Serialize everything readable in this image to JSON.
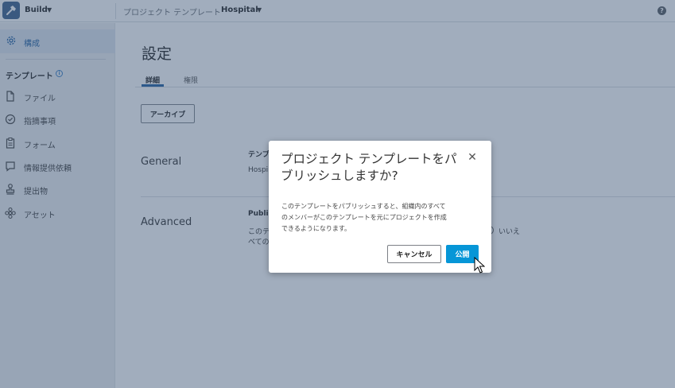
{
  "topbar": {
    "app_name": "Build",
    "crumb_label": "プロジェクト テンプレート",
    "crumb_value": "Hospital"
  },
  "sidebar": {
    "active_item": {
      "label": "構成",
      "icon": "gear-icon"
    },
    "heading": "テンプレート",
    "items": [
      {
        "label": "ファイル",
        "icon": "file-icon"
      },
      {
        "label": "指摘事項",
        "icon": "check-circle-icon"
      },
      {
        "label": "フォーム",
        "icon": "clipboard-icon"
      },
      {
        "label": "情報提供依頼",
        "icon": "chat-bubble-icon"
      },
      {
        "label": "提出物",
        "icon": "stamp-icon"
      },
      {
        "label": "アセット",
        "icon": "asset-icon"
      }
    ]
  },
  "main": {
    "title": "設定",
    "tabs": [
      {
        "label": "詳細",
        "active": true
      },
      {
        "label": "権限",
        "active": false
      }
    ],
    "archive_button": "アーカイブ",
    "sections": {
      "general": {
        "title": "General",
        "field_label_partial": "テンプ",
        "field_value_partial": "Hospi"
      },
      "advanced": {
        "title": "Advanced",
        "field_label_partial": "Publis",
        "field_text_line1_partial": "このテ",
        "field_text_line2_partial": "べての",
        "radio_no_label": "いいえ"
      }
    }
  },
  "dialog": {
    "title": "プロジェクト テンプレートをパブリッシュしますか?",
    "title_line1": "プロジェクト テンプレートをパ",
    "title_line2": "ブリッシュしますか?",
    "body_line1": "このテンプレートをパブリッシュすると、組織内のすべて",
    "body_line2": "のメンバーがこのテンプレートを元にプロジェクトを作成",
    "body_line3": "できるようになります。",
    "cancel_label": "キャンセル",
    "publish_label": "公開"
  },
  "colors": {
    "accent": "#1f5fa0",
    "primary_button": "#0696d7",
    "overlay": "#3a5375"
  }
}
